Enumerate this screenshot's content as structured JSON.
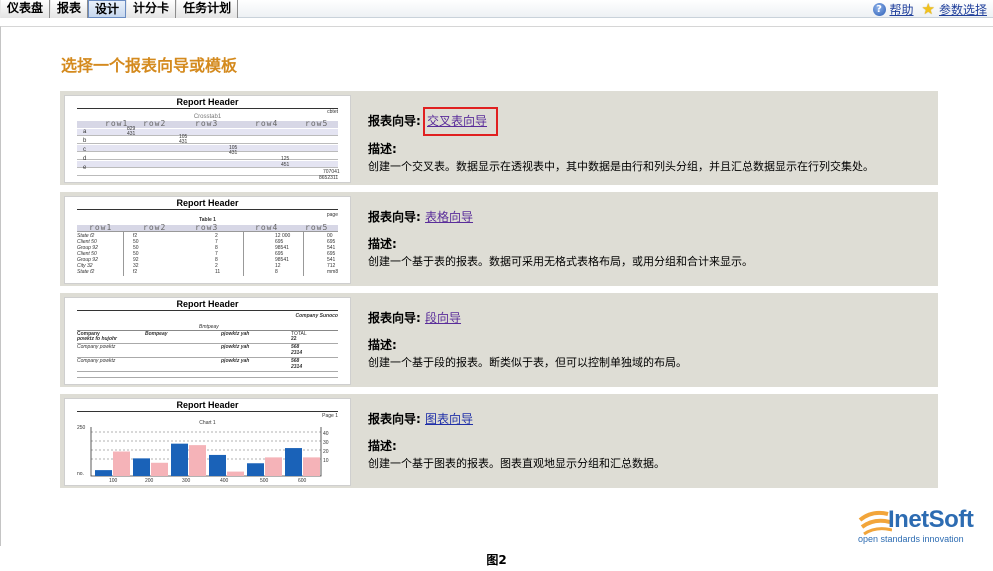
{
  "tabs": [
    {
      "label": "仪表盘"
    },
    {
      "label": "报表"
    },
    {
      "label": "设计"
    },
    {
      "label": "计分卡"
    },
    {
      "label": "任务计划"
    }
  ],
  "top_links": {
    "help": "帮助",
    "prefs": "参数选择"
  },
  "page_title": "选择一个报表向导或模板",
  "wizard_prefix": "报表向导:",
  "desc_prefix": "描述:",
  "cards": [
    {
      "link": "交叉表向导",
      "desc": "创建一个交叉表。数据显示在透视表中，其中数据是由行和列头分组，并且汇总数据显示在行列交集处。",
      "thumb": {
        "header": "Report Header",
        "corner": "cbtet",
        "title": "Crosstab1",
        "cols": [
          "row1",
          "row2",
          "row3",
          "row4",
          "row5"
        ],
        "rows": [
          "a",
          "b",
          "c",
          "d",
          "e"
        ],
        "cells": [
          "829",
          "431",
          "105",
          "431",
          "105",
          "431",
          "125",
          "451",
          "707041",
          "8652311"
        ]
      }
    },
    {
      "link": "表格向导",
      "desc": "创建一个基于表的报表。数据可采用无格式表格布局，或用分组和合计来显示。",
      "thumb": {
        "header": "Report Header",
        "corner": "page",
        "title": "Table 1",
        "cols": [
          "row1",
          "row2",
          "row3",
          "row4",
          "row5"
        ],
        "rows": [
          "State f2",
          "Client 50",
          "Group 92",
          "Client 50",
          "Group 92",
          "City 32",
          "State f2"
        ],
        "c2": [
          "f2",
          "50",
          "50",
          "50",
          "92",
          "32",
          "f2"
        ],
        "c3": [
          "2",
          "7",
          "8",
          "7",
          "8",
          "2",
          "11"
        ],
        "c4": [
          "12 000",
          "695",
          "98541",
          "695",
          "98541",
          "12",
          "8"
        ],
        "c5": [
          "00",
          "695",
          "541",
          "695",
          "541",
          "712",
          "mm8"
        ]
      }
    },
    {
      "link": "段向导",
      "desc": "创建一个基于段的报表。断类似于表，但可以控制单独域的布局。",
      "thumb": {
        "header": "Report Header",
        "corner": "Company Sunoco",
        "sub": "Bmtpeay",
        "h1": "Company",
        "h2": "Bompeay",
        "h3": "pjowktz yah",
        "h4": "TOTAL",
        "r1a": "powktz fo hujohr",
        "r1d": "22",
        "r2a": "Company powktz",
        "r2c": "pjowktz yah",
        "r2d": "568",
        "r2e": "2314",
        "r3a": "Company powktz",
        "r3c": "pjowktz yah",
        "r3d": "568",
        "r3e": "2314"
      }
    },
    {
      "link": "图表向导",
      "desc": "创建一个基于图表的报表。图表直观地显示分组和汇总数据。",
      "thumb": {
        "header": "Report Header",
        "corner": "Page 1",
        "title": "Chart 1",
        "yleft_top": "250",
        "yleft_bottom": "no.",
        "yright": [
          "40",
          "30",
          "20",
          "10"
        ],
        "xlabels": [
          "100",
          "200",
          "300",
          "400",
          "500",
          "600"
        ],
        "blue": [
          0.12,
          0.36,
          0.66,
          0.43,
          0.26,
          0.57
        ],
        "pink": [
          0.5,
          0.27,
          0.63,
          0.09,
          0.38,
          0.38
        ]
      }
    }
  ],
  "colors": {
    "accent_title": "#d48a1e",
    "card_bg": "#deddd5",
    "highlight": "#e02020",
    "bar_blue": "#1a62b8",
    "bar_pink": "#f5b3b8"
  },
  "caption": "图2",
  "logo": {
    "name": "InetSoft",
    "tagline": "open standards innovation"
  }
}
